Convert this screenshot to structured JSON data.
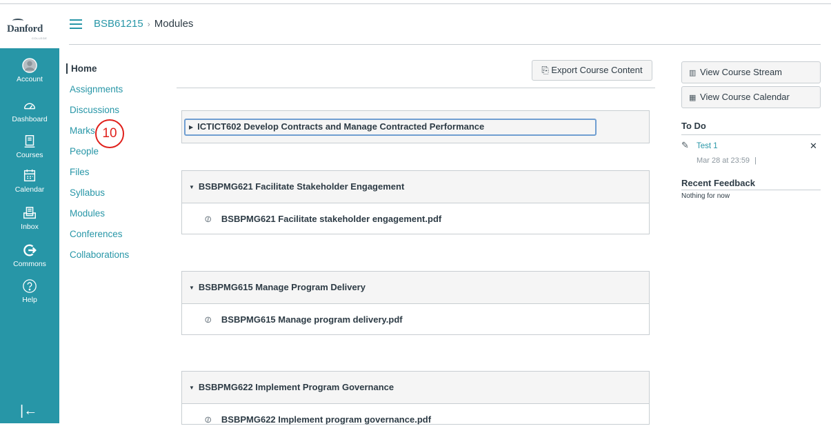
{
  "brand": {
    "name": "Danford",
    "sub": "COLLEGE"
  },
  "global_nav": {
    "items": [
      {
        "label": "Account",
        "icon": "account-icon"
      },
      {
        "label": "Dashboard",
        "icon": "dashboard-icon"
      },
      {
        "label": "Courses",
        "icon": "courses-icon"
      },
      {
        "label": "Calendar",
        "icon": "calendar-icon"
      },
      {
        "label": "Inbox",
        "icon": "inbox-icon"
      },
      {
        "label": "Commons",
        "icon": "commons-icon"
      },
      {
        "label": "Help",
        "icon": "help-icon"
      }
    ],
    "collapse_glyph": "|←",
    "color": "#2796a7"
  },
  "breadcrumb": {
    "course": "BSB61215",
    "separator": "›",
    "current": "Modules"
  },
  "course_nav": {
    "items": [
      {
        "label": "Home",
        "active": true
      },
      {
        "label": "Assignments"
      },
      {
        "label": "Discussions"
      },
      {
        "label": "Marks"
      },
      {
        "label": "People"
      },
      {
        "label": "Files"
      },
      {
        "label": "Syllabus"
      },
      {
        "label": "Modules"
      },
      {
        "label": "Conferences"
      },
      {
        "label": "Collaborations"
      }
    ]
  },
  "annotation_marker": "10",
  "main": {
    "export_button": "Export Course Content",
    "modules": [
      {
        "title": "ICTICT602 Develop Contracts and Manage Contracted Performance",
        "collapsed": true,
        "items": []
      },
      {
        "title": "BSBPMG621 Facilitate Stakeholder Engagement",
        "collapsed": false,
        "items": [
          "BSBPMG621 Facilitate stakeholder engagement.pdf"
        ]
      },
      {
        "title": "BSBPMG615 Manage Program Delivery",
        "collapsed": false,
        "items": [
          "BSBPMG615 Manage program delivery.pdf"
        ]
      },
      {
        "title": "BSBPMG622 Implement Program Governance",
        "collapsed": false,
        "items": [
          "BSBPMG622 Implement program governance.pdf"
        ]
      }
    ]
  },
  "sidebar": {
    "view_stream": "View Course Stream",
    "view_calendar": "View Course Calendar",
    "todo_heading": "To Do",
    "todo": {
      "title": "Test 1",
      "due": "Mar 28 at 23:59",
      "due_sep": "|",
      "dismiss": "✕"
    },
    "feedback_heading": "Recent Feedback",
    "feedback_text": "Nothing for now"
  }
}
